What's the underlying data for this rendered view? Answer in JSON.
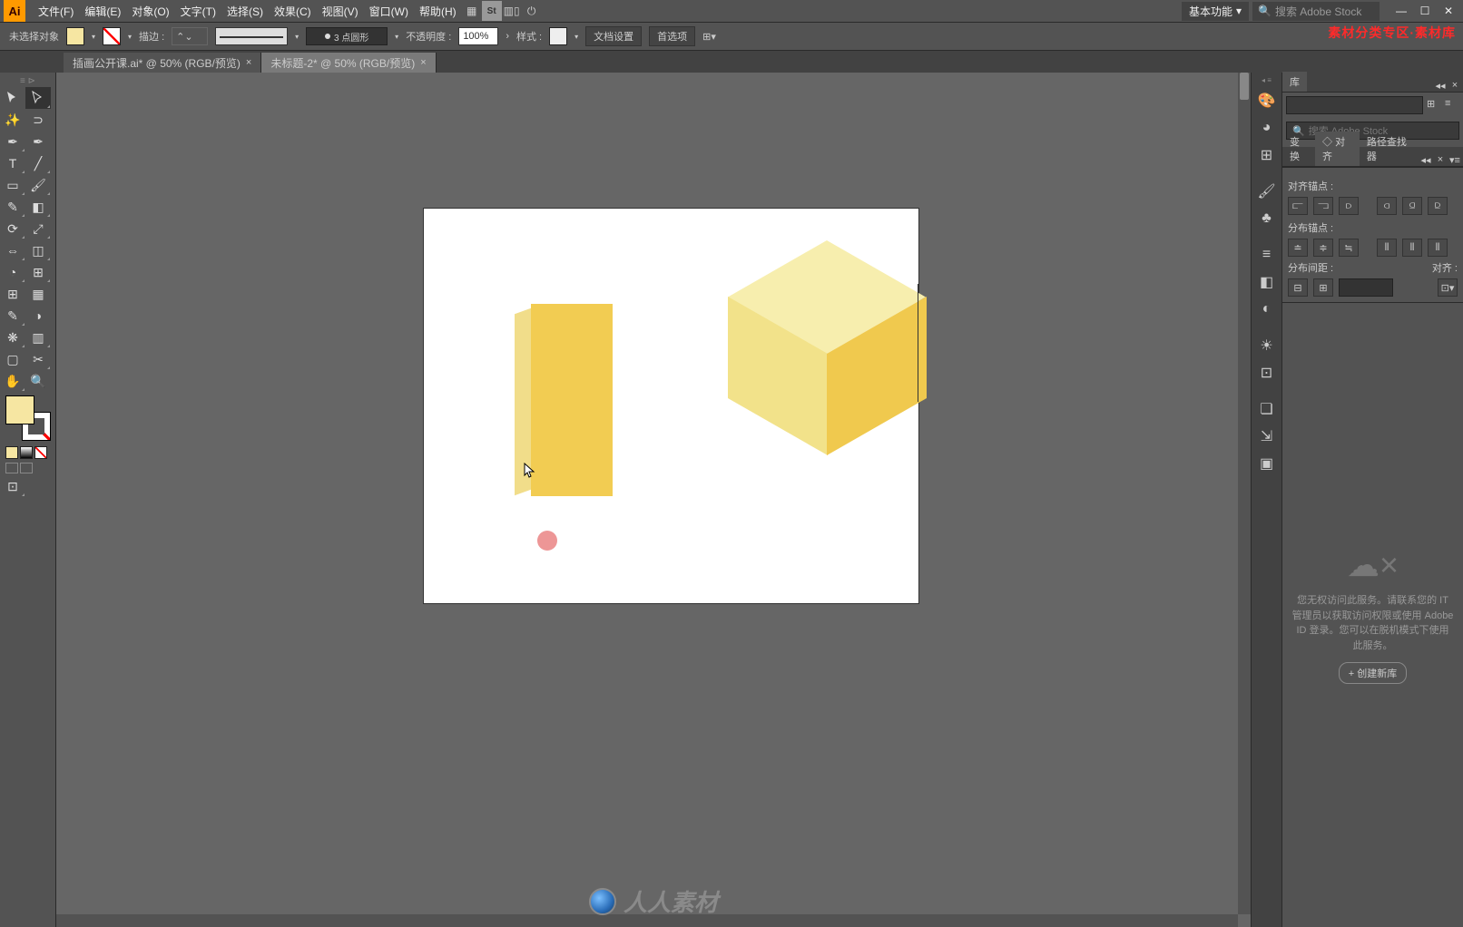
{
  "menu": {
    "items": [
      "文件(F)",
      "编辑(E)",
      "对象(O)",
      "文字(T)",
      "选择(S)",
      "效果(C)",
      "视图(V)",
      "窗口(W)",
      "帮助(H)"
    ],
    "workspace": "基本功能",
    "search_placeholder": "搜索 Adobe Stock"
  },
  "control": {
    "status": "未选择对象",
    "stroke_label": "描边 :",
    "stroke_profile": "3 点圆形",
    "opacity_label": "不透明度 :",
    "opacity_value": "100%",
    "style_label": "样式 :",
    "doc_setup": "文档设置",
    "prefs": "首选项"
  },
  "tabs": [
    {
      "label": "插画公开课.ai* @ 50% (RGB/预览)",
      "active": false
    },
    {
      "label": "未标题-2* @ 50% (RGB/预览)",
      "active": true
    }
  ],
  "panels": {
    "library_tab": "库",
    "search_placeholder": "搜索 Adobe Stock",
    "transform_tab": "变换",
    "align_tab": "◇ 对齐",
    "pathfinder_tab": "路径查找器",
    "align_anchor_label": "对齐锚点 :",
    "distribute_anchor_label": "分布锚点 :",
    "distribute_spacing_label": "分布间距 :",
    "align_to_label": "对齐 :",
    "lib_msg": "您无权访问此服务。请联系您的 IT 管理员以获取访问权限或使用 Adobe ID 登录。您可以在脱机模式下使用此服务。",
    "new_library": "+ 创建新库"
  },
  "watermark": {
    "top": "素材分类专区·素材库",
    "bottom": "人人素材"
  }
}
